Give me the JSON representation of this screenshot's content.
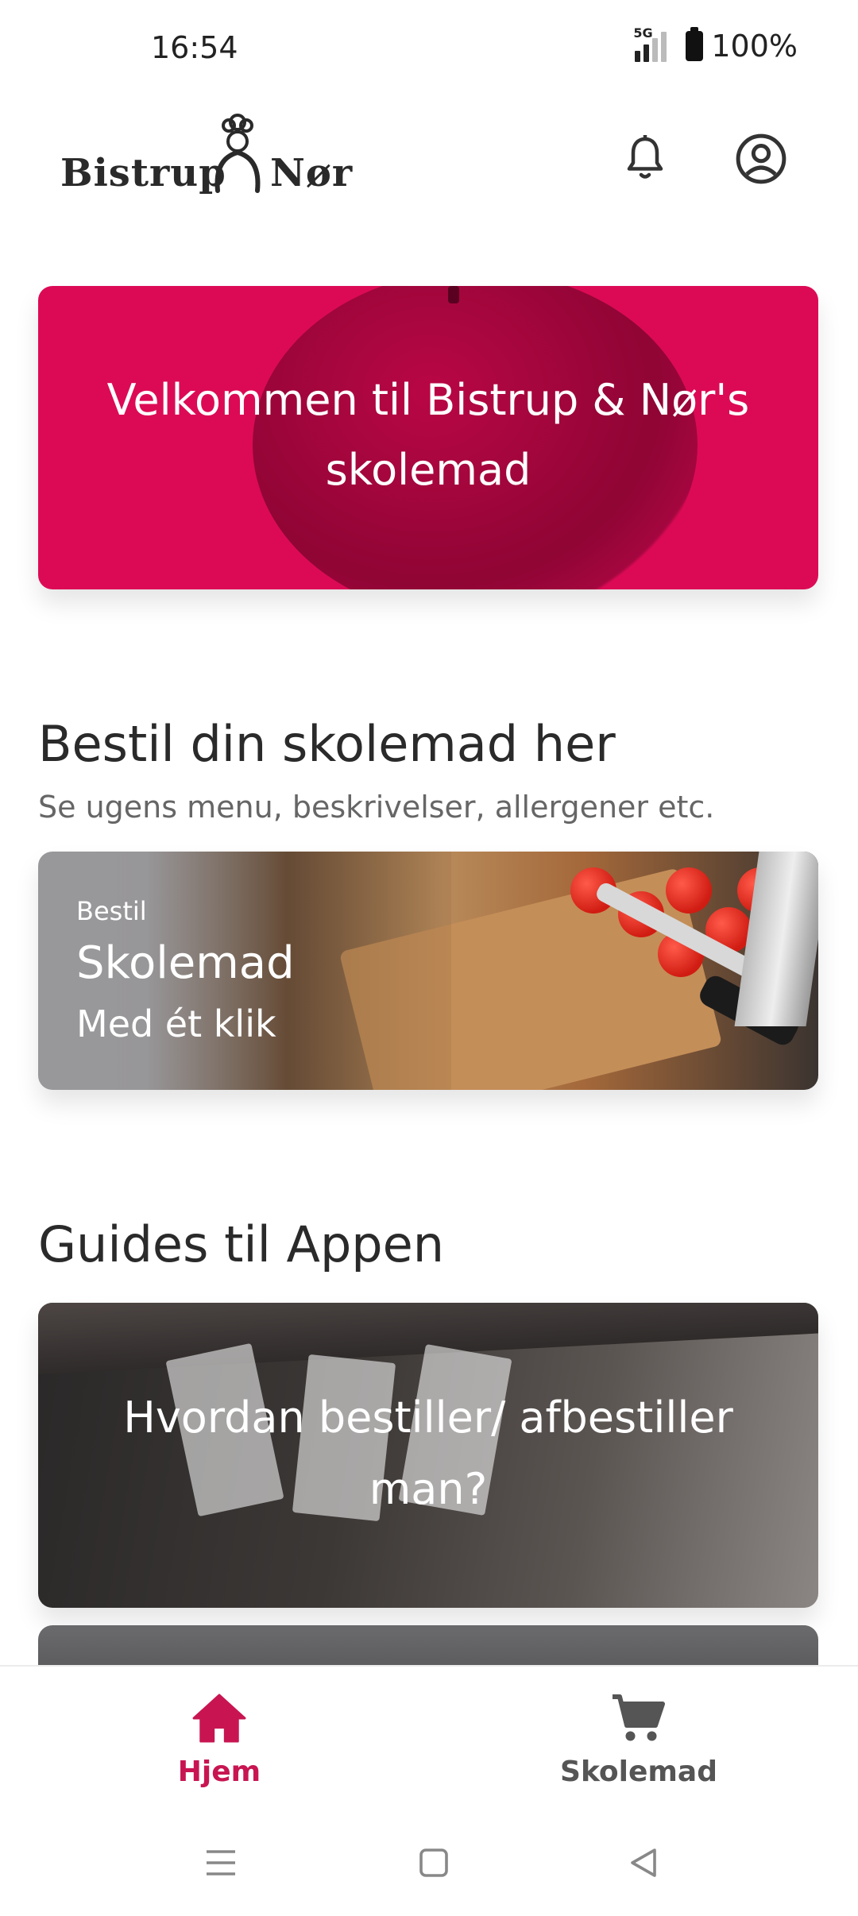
{
  "status": {
    "time": "16:54",
    "network": "5G",
    "battery": "100%"
  },
  "header": {
    "logo_left": "Bistrup",
    "logo_right": "Nør"
  },
  "hero": {
    "title": "Velkommen til Bistrup & Nør's skolemad"
  },
  "order_section": {
    "title": "Bestil din skolemad her",
    "subtitle": "Se ugens menu, beskrivelser, allergener etc.",
    "card": {
      "kicker": "Bestil",
      "title": "Skolemad",
      "subtitle": "Med ét klik"
    }
  },
  "guides_section": {
    "title": "Guides til Appen",
    "card": {
      "title": "Hvordan bestiller/ afbestiller man?"
    }
  },
  "bottom_nav": {
    "items": [
      {
        "label": "Hjem",
        "icon": "home-icon",
        "active": true
      },
      {
        "label": "Skolemad",
        "icon": "cart-icon",
        "active": false
      }
    ]
  },
  "colors": {
    "accent": "#dc0a55",
    "active_nav": "#c81552",
    "text": "#2a2a2a",
    "muted": "#666666"
  }
}
